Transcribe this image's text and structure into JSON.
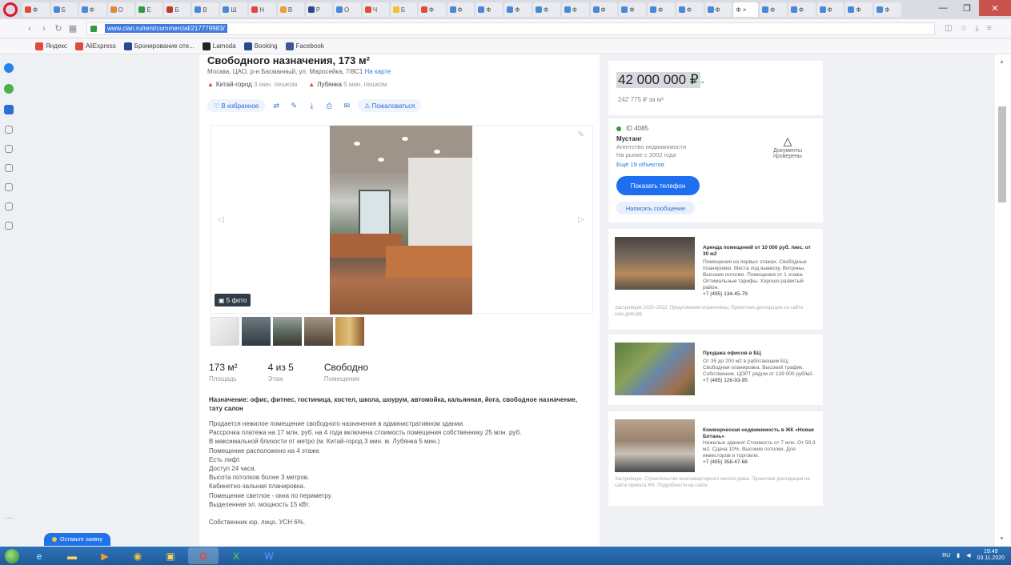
{
  "browser": {
    "tabs": [
      {
        "label": "Ф",
        "color": "#e04a3a"
      },
      {
        "label": "Б",
        "color": "#4a88d9"
      },
      {
        "label": "Ф",
        "color": "#4a88d9"
      },
      {
        "label": "О",
        "color": "#e08a3a"
      },
      {
        "label": "Е",
        "color": "#2e9b3c"
      },
      {
        "label": "Б",
        "color": "#c0392b"
      },
      {
        "label": "В",
        "color": "#4a88d9"
      },
      {
        "label": "Ш",
        "color": "#4a88d9"
      },
      {
        "label": "Н",
        "color": "#e04a3a"
      },
      {
        "label": "В",
        "color": "#f0a030"
      },
      {
        "label": "Р",
        "color": "#2a4a8f"
      },
      {
        "label": "О",
        "color": "#4a88d9"
      },
      {
        "label": "Ч",
        "color": "#e04a3a"
      },
      {
        "label": "Б",
        "color": "#f0c030"
      },
      {
        "label": "Ф",
        "color": "#e04a3a"
      },
      {
        "label": "Ф",
        "color": "#4a88d9"
      },
      {
        "label": "Ф",
        "color": "#4a88d9"
      },
      {
        "label": "Ф",
        "color": "#4a88d9"
      },
      {
        "label": "Ф",
        "color": "#4a88d9"
      },
      {
        "label": "Ф",
        "color": "#4a88d9"
      },
      {
        "label": "Ф",
        "color": "#4a88d9"
      },
      {
        "label": "Ф",
        "color": "#4a88d9"
      },
      {
        "label": "Ф",
        "color": "#4a88d9"
      },
      {
        "label": "Ф",
        "color": "#4a88d9"
      },
      {
        "label": "Ф",
        "color": "#4a88d9"
      },
      {
        "label": "Ф",
        "color": "#4a88d9"
      },
      {
        "label": "Ф",
        "color": "#4a88d9"
      },
      {
        "label": "Ф",
        "color": "#4a88d9"
      },
      {
        "label": "Ф",
        "color": "#4a88d9"
      },
      {
        "label": "Ф",
        "color": "#4a88d9"
      }
    ],
    "active_tab_label": "Ф ×",
    "url": "www.cian.ru/rent/commercial/217779983/",
    "bookmarks": [
      {
        "label": "Яндекс",
        "color": "#e04a3a"
      },
      {
        "label": "AliExpress",
        "color": "#e04a3a"
      },
      {
        "label": "Бронирование оте...",
        "color": "#2a4a8f"
      },
      {
        "label": "Lamoda",
        "color": "#222222"
      },
      {
        "label": "Booking",
        "color": "#2a4a8f"
      },
      {
        "label": "Facebook",
        "color": "#3b5998"
      }
    ]
  },
  "listing": {
    "title": "Свободного назначения, 173 м²",
    "address": "Москва, ЦАО, р-н Басманный, ул. Маросейка, 7/8С1",
    "map_link": "На карте",
    "metro": [
      {
        "name": "Китай-город",
        "dist": "3 мин. пешком"
      },
      {
        "name": "Лубянка",
        "dist": "5 мин. пешком"
      }
    ],
    "actions": {
      "favorite": "♡ В избранное",
      "complain": "⚠ Пожаловаться"
    },
    "photo_count": "▣ 5 фото",
    "facts": [
      {
        "value": "173 м²",
        "label": "Площадь"
      },
      {
        "value": "4 из 5",
        "label": "Этаж"
      },
      {
        "value": "Свободно",
        "label": "Помещение"
      }
    ],
    "purpose": "Назначение: офис, фитнес, гостиница, хостел, школа, шоурум, автомойка, кальянная, йога, свободное назначение, тату салон",
    "description": [
      "Продается нежилое помещение свободного назначения в административном здании.",
      "Рассрочка платежа на 17 млн. руб. на 4 года включена стоимость помещения собственнику 25 млн. руб.",
      "В максимальной близости от метро (м. Китай-город 3 мин. м. Лубянка 5 мин.)",
      "Помещение расположено на 4 этаже.",
      "Есть лифт.",
      "Доступ 24 часа.",
      "Высота потолков более 3 метров.",
      "Кабинетно-зальная планировка.",
      "Помещение светлое - окна по периметру.",
      "Выделенная эл. мощность 15 кВт.",
      "",
      "Собственник юр. лицо. УСН 6%."
    ]
  },
  "price": {
    "value": "42 000 000 ₽",
    "per_meter": "242 775 ₽ за м²"
  },
  "seller": {
    "id": "ID 4085",
    "name": "Мустанг",
    "role_line1": "Агентство недвижимости",
    "role_line2": "На рынке с 2002 года",
    "link": "Ещё 19 объектов",
    "docs_label": "Документы проверены",
    "phone_button": "Показать телефон",
    "message_button": "Написать сообщение"
  },
  "ads": [
    {
      "title": "Аренда помещений от 10 000 руб. /мес. от 30 м2",
      "text": "Помещения на первых этажах. Свободные планировки. Места под вывеску. Витрины. Высокие потолки. Помещения от 1 этажа. Оптимальные тарифы. Хорошо развитый район.",
      "phone": "+7 (495) 134-45-79",
      "foot": "Застройщик 2020–2022. Предложения ограничены. Проектная декларация на сайте наш.дом.рф"
    },
    {
      "title": "Продажа офисов в БЦ",
      "text": "От 35 до 200 м2 в работающем БЦ. Свободная планировка. Высокий трафик. Собственник. ЦОРТ рядом от 129 000 руб/м2.",
      "phone": "+7 (495) 126-93-95",
      "foot": ""
    },
    {
      "title": "Коммерческая недвижимость в ЖК «Новая Ботань»",
      "text": "Нежилые здания! Стоимость от 7 млн. От 50,3 м2. Сдача 10%. Высокие потолки. Для инвесторов и торговли.",
      "phone": "+7 (495) 358-47-68",
      "foot": "Застройщик. Строительство многоквартирного жилого дома. Проектная декларация на сайте проекта ЖК. Подробности на сайте"
    }
  ],
  "chat": {
    "label": "Оставьте заявку"
  },
  "taskbar": {
    "clock_time": "19:49",
    "clock_date": "03.11.2020",
    "tray_lang": "RU"
  }
}
